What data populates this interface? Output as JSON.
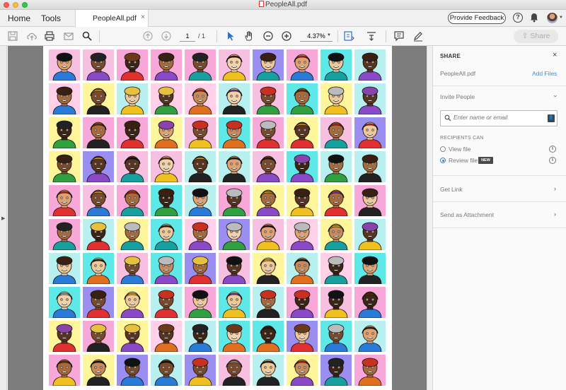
{
  "window": {
    "title": "PeopleAll.pdf"
  },
  "tabbar": {
    "home": "Home",
    "tools": "Tools",
    "doc_tab": "PeopleAll.pdf",
    "close": "×",
    "feedback": "Provide Feedback",
    "help": "?"
  },
  "toolbar": {
    "page_current": "1",
    "page_total": "/ 1",
    "zoom": "4.37%",
    "share": "Share"
  },
  "share_panel": {
    "heading": "SHARE",
    "close": "×",
    "file_name": "PeopleAll.pdf",
    "add_files": "Add Files",
    "invite_label": "Invite People",
    "invite_placeholder": "Enter name or email",
    "recipients_label": "RECIPIENTS CAN",
    "view_option": "View file",
    "review_option": "Review file",
    "new_badge": "NEW",
    "get_link": "Get Link",
    "send_attachment": "Send as Attachment",
    "selected_option": "Review file"
  },
  "icons": {
    "toolbar": [
      "save-icon",
      "upload-icon",
      "print-icon",
      "mail-icon",
      "search-icon",
      "page-up-icon",
      "page-down-icon",
      "pointer-icon",
      "hand-icon",
      "zoom-out-icon",
      "zoom-in-icon",
      "fit-page-icon",
      "scroll-mode-icon",
      "comment-icon",
      "sign-icon"
    ]
  },
  "colors": {
    "tile_palette": [
      "#fff59a",
      "#f8a8d8",
      "#5ee8e8",
      "#f8c0e0",
      "#9a8ef0",
      "#ffd0e8",
      "#b8f0f0"
    ],
    "accent": "#3b7bd5",
    "pointer_active": "#2d6fd1"
  }
}
